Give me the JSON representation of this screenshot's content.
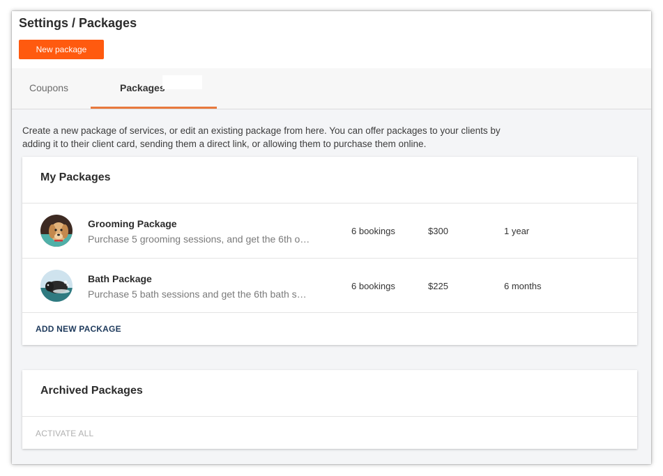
{
  "page": {
    "title": "Settings / Packages"
  },
  "header": {
    "new_package_label": "New package",
    "accent_color": "#ff5a0f"
  },
  "tabs": [
    {
      "label": "Coupons",
      "active": false
    },
    {
      "label": "Packages",
      "active": true
    }
  ],
  "intro_text": "Create a new package of services, or edit an existing package from here. You can offer packages to your clients by adding it to their client card, sending them a direct link, or allowing them to purchase them online.",
  "my_packages": {
    "title": "My Packages",
    "items": [
      {
        "icon": "dog-avatar",
        "name": "Grooming Package",
        "description": "Purchase 5 grooming sessions, and get the 6th o…",
        "bookings": "6 bookings",
        "price": "$300",
        "duration": "1 year"
      },
      {
        "icon": "dog-bath-avatar",
        "name": "Bath Package",
        "description": "Purchase 5 bath sessions and get the 6th bath s…",
        "bookings": "6 bookings",
        "price": "$225",
        "duration": "6 months"
      }
    ],
    "add_label": "ADD NEW PACKAGE"
  },
  "archived_packages": {
    "title": "Archived Packages",
    "activate_label": "ACTIVATE ALL"
  }
}
